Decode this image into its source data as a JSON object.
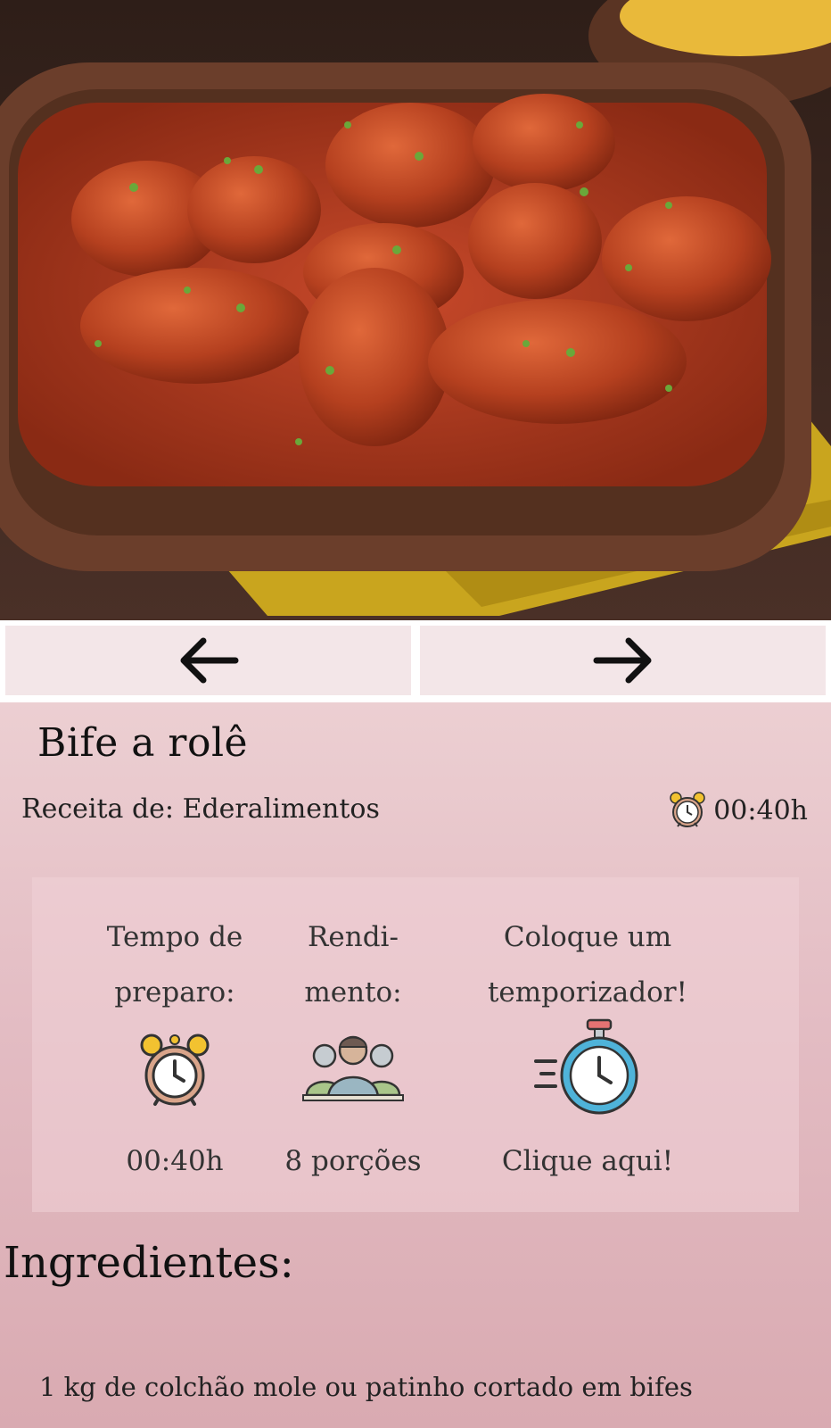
{
  "recipe": {
    "title": "Bife a rolê",
    "author": "Receita de: Ederalimentos",
    "time_short": "00:40h"
  },
  "info": {
    "prep_label_1": "Tempo de",
    "prep_label_2": "preparo:",
    "prep_value": "00:40h",
    "yield_label_1": "Rendi-",
    "yield_label_2": "mento:",
    "yield_value": "8 porções",
    "timer_label_1": "Coloque um",
    "timer_label_2": "temporizador!",
    "timer_action": "Clique aqui!"
  },
  "ingredients": {
    "heading": "Ingredientes:",
    "items": [
      "1 kg de colchão mole ou patinho cortado em bifes"
    ]
  },
  "icons": {
    "prev": "arrow-left-icon",
    "next": "arrow-right-icon",
    "alarm": "alarm-clock-icon",
    "people": "people-group-icon",
    "stopwatch": "stopwatch-icon"
  },
  "colors": {
    "nav_button_bg": "#f3e6e8",
    "content_bg": "#e3bcc3",
    "sauce": "#b43a1e",
    "napkin": "#c9a51e"
  }
}
